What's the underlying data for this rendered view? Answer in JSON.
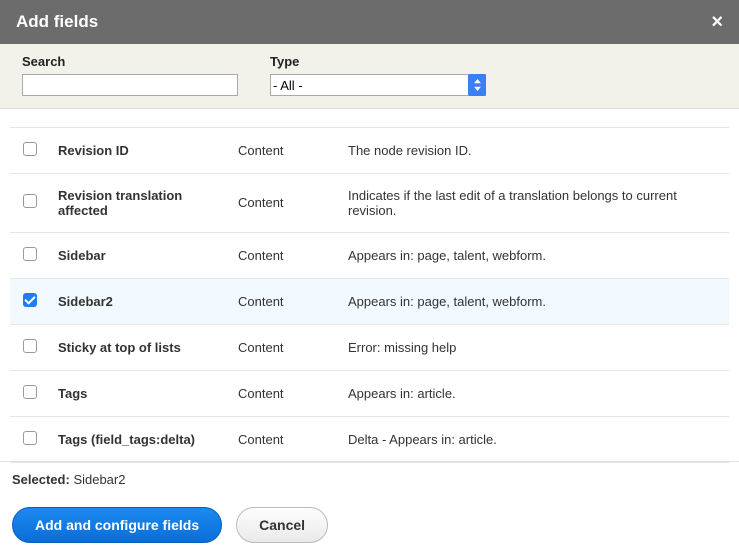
{
  "header": {
    "title": "Add fields"
  },
  "filters": {
    "search_label": "Search",
    "search_value": "",
    "type_label": "Type",
    "type_selected": "- All -"
  },
  "rows": [
    {
      "name": "Revision ID",
      "category": "Content",
      "description": "The node revision ID.",
      "checked": false
    },
    {
      "name": "Revision translation affected",
      "category": "Content",
      "description": "Indicates if the last edit of a translation belongs to current revision.",
      "checked": false
    },
    {
      "name": "Sidebar",
      "category": "Content",
      "description": "Appears in: page, talent, webform.",
      "checked": false
    },
    {
      "name": "Sidebar2",
      "category": "Content",
      "description": "Appears in: page, talent, webform.",
      "checked": true
    },
    {
      "name": "Sticky at top of lists",
      "category": "Content",
      "description": "Error: missing help",
      "checked": false
    },
    {
      "name": "Tags",
      "category": "Content",
      "description": "Appears in: article.",
      "checked": false
    },
    {
      "name": "Tags (field_tags:delta)",
      "category": "Content",
      "description": "Delta - Appears in: article.",
      "checked": false
    }
  ],
  "footer": {
    "selected_label": "Selected:",
    "selected_value": "Sidebar2",
    "primary_button": "Add and configure fields",
    "cancel_button": "Cancel"
  }
}
